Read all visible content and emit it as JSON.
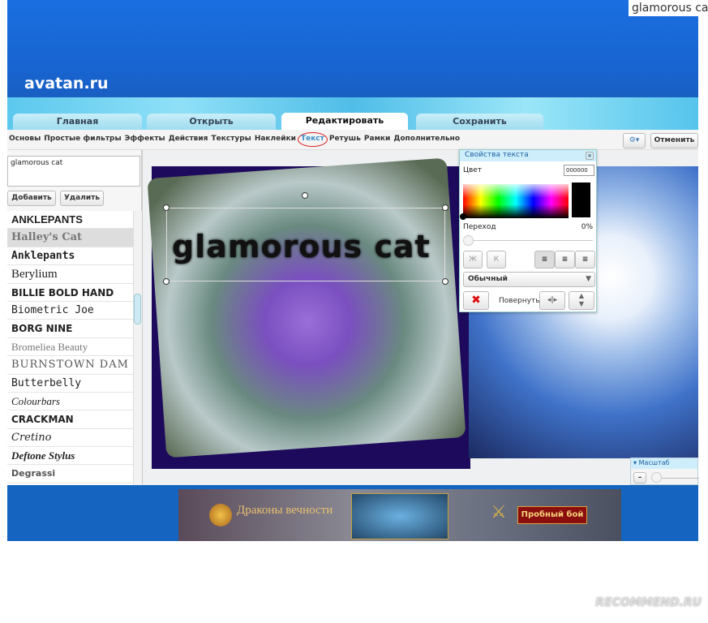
{
  "caption": "glamorous cat",
  "site": {
    "logo": "avatan.ru"
  },
  "tabs": [
    {
      "label": "Главная"
    },
    {
      "label": "Открыть"
    },
    {
      "label": "Редактировать",
      "active": true
    },
    {
      "label": "Сохранить"
    }
  ],
  "menu": [
    "Основы",
    "Простые фильтры",
    "Эффекты",
    "Действия",
    "Текстуры",
    "Наклейки",
    "Текст",
    "Ретушь",
    "Рамки",
    "Дополнительно"
  ],
  "menu_selected": "Текст",
  "toolbar": {
    "settings_icon": "gear-icon",
    "cancel_label": "Отменить"
  },
  "left": {
    "text_value": "glamorous cat",
    "add_label": "Добавить",
    "delete_label": "Удалить",
    "fonts": [
      "ANKLEPANTS",
      "Halley's Cat",
      "Anklepants",
      "Berylium",
      "BILLIE BOLD HAND",
      "Biometric Joe",
      "BORG NINE",
      "Bromeliea Beauty",
      "BURNSTOWN DAM",
      "Butterbelly",
      "Colourbars",
      "CRACKMAN",
      "Cretino",
      "Deftone Stylus",
      "Degrassi"
    ],
    "selected_font": "Halley's Cat"
  },
  "canvas": {
    "overlay_text": "glamorous cat"
  },
  "props": {
    "title": "Свойства текста",
    "color_label": "Цвет",
    "color_value": "000000",
    "transition_label": "Переход",
    "transition_value": "0%",
    "bold": "Ж",
    "italic": "К",
    "style_value": "Обычный",
    "rotate_label": "Повернуть:",
    "accent": "#cfeefc"
  },
  "zoom": {
    "title": "Масштаб"
  },
  "ad": {
    "brand": "Драконы вечности",
    "button": "Пробный бой"
  },
  "watermark": "RECOMMEND.RU"
}
